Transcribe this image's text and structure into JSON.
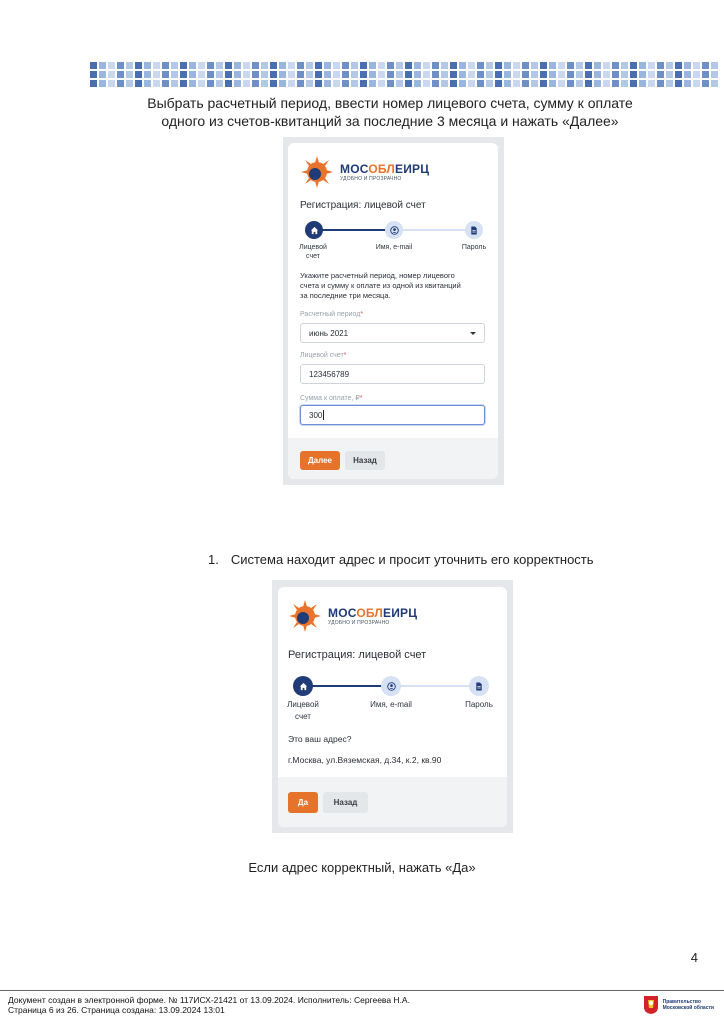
{
  "intro": {
    "line1": "Выбрать расчетный период, ввести номер лицевого счета, сумму к оплате",
    "line2": "одного из счетов-квитанций за последние 3 месяца и нажать «Далее»"
  },
  "brand": {
    "name_start": "МОС",
    "name_mid": "ОБЛ",
    "name_end": "ЕИРЦ",
    "tagline": "УДОБНО И ПРОЗРАЧНО"
  },
  "screen1": {
    "title": "Регистрация: лицевой счет",
    "steps": [
      "Лицевой",
      "счет",
      "Имя, e-mail",
      "Пароль"
    ],
    "instruction": [
      "Укажите расчетный период, номер лицевого",
      "счета и сумму к оплате из одной из квитанций",
      "за последние три месяца."
    ],
    "period_label": "Расчетный период",
    "period_value": "июнь 2021",
    "account_label": "Лицевой счет",
    "account_value": "123456789",
    "amount_label": "Сумма к оплате, ₽",
    "amount_value": "300",
    "required_mark": "*",
    "next_button": "Далее",
    "back_button": "Назад"
  },
  "list_item": {
    "number": "1.",
    "text": "Система находит адрес и просит уточнить его корректность"
  },
  "screen2": {
    "title": "Регистрация: лицевой счет",
    "steps": [
      "Лицевой",
      "счет",
      "Имя, e-mail",
      "Пароль"
    ],
    "question": "Это ваш адрес?",
    "address": "г.Москва, ул.Вяземская, д.34, к.2, кв.90",
    "yes_button": "Да",
    "back_button": "Назад"
  },
  "caption": "Если адрес корректный, нажать «Да»",
  "page_number": "4",
  "footer": {
    "line1": "Документ создан в электронной форме. № 117ИСХ-21421 от 13.09.2024. Исполнитель: Сергеева Н.А.",
    "line2": "Страница 6 из 26. Страница создана: 13.09.2024 13:01",
    "gov_line1": "Правительство",
    "gov_line2": "Московской области"
  },
  "colors": {
    "accent": "#e6732c",
    "brand_navy": "#1f3b78",
    "step_light": "#d6e1f4"
  }
}
